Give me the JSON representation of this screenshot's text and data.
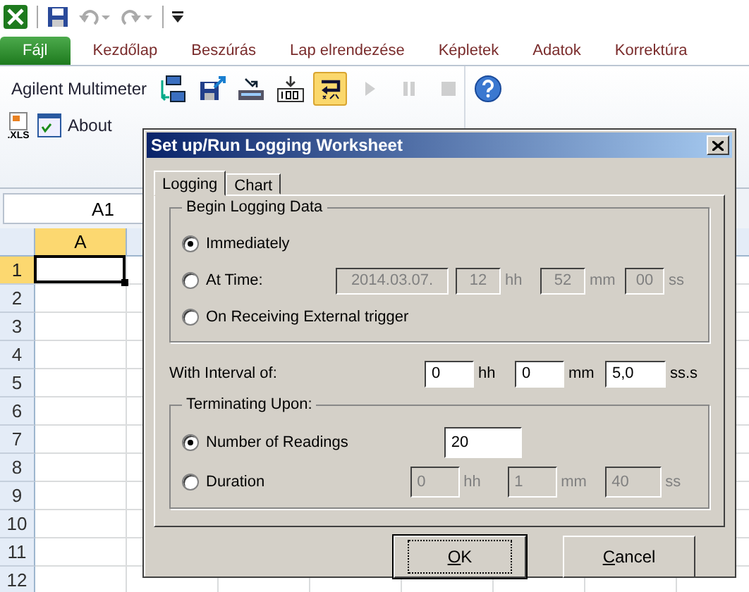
{
  "ribbon_tabs": [
    {
      "label": "Fájl",
      "kind": "file"
    },
    {
      "label": "Kezdőlap",
      "kind": "tab"
    },
    {
      "label": "Beszúrás",
      "kind": "tab"
    },
    {
      "label": "Lap elrendezése",
      "kind": "tab"
    },
    {
      "label": "Képletek",
      "kind": "tab"
    },
    {
      "label": "Adatok",
      "kind": "tab"
    },
    {
      "label": "Korrektúra",
      "kind": "tab"
    }
  ],
  "ribbon": {
    "addin_label": "Agilent Multimeter",
    "about_label": "About",
    "xls_icon_text": ".XLS",
    "tools": [
      {
        "kind": "connect",
        "active": false,
        "disabled": false
      },
      {
        "kind": "save",
        "active": false,
        "disabled": false
      },
      {
        "kind": "meter",
        "active": false,
        "disabled": false
      },
      {
        "kind": "reading",
        "active": false,
        "disabled": false
      },
      {
        "kind": "logging",
        "active": true,
        "disabled": false
      },
      {
        "kind": "play",
        "active": false,
        "disabled": true
      },
      {
        "kind": "pause",
        "active": false,
        "disabled": true
      },
      {
        "kind": "stop",
        "active": false,
        "disabled": true
      },
      {
        "kind": "help",
        "active": false,
        "disabled": false
      }
    ]
  },
  "name_box": "A1",
  "columns": [
    {
      "label": "A",
      "selected": true
    }
  ],
  "rows": [
    {
      "label": "1",
      "selected": true
    },
    {
      "label": "2",
      "selected": false
    },
    {
      "label": "3",
      "selected": false
    },
    {
      "label": "4",
      "selected": false
    },
    {
      "label": "5",
      "selected": false
    },
    {
      "label": "6",
      "selected": false
    },
    {
      "label": "7",
      "selected": false
    },
    {
      "label": "8",
      "selected": false
    },
    {
      "label": "9",
      "selected": false
    },
    {
      "label": "10",
      "selected": false
    },
    {
      "label": "11",
      "selected": false
    },
    {
      "label": "12",
      "selected": false
    }
  ],
  "dialog": {
    "title": "Set up/Run Logging Worksheet",
    "tabs": [
      {
        "label": "Logging",
        "selected": true
      },
      {
        "label": "Chart",
        "selected": false
      }
    ],
    "begin_group": {
      "title": "Begin Logging Data",
      "options": [
        {
          "label": "Immediately",
          "selected": true
        },
        {
          "label": "At Time:",
          "selected": false
        },
        {
          "label": "On Receiving External trigger",
          "selected": false
        }
      ],
      "time_fields": [
        {
          "value": "2014.03.07.",
          "disabled": true
        },
        {
          "value": "12",
          "unit": "hh",
          "disabled": true
        },
        {
          "value": "52",
          "unit": "mm",
          "disabled": true
        },
        {
          "value": "00",
          "unit": "ss",
          "disabled": true
        }
      ]
    },
    "interval": {
      "label": "With Interval of:",
      "fields": [
        {
          "value": "0",
          "unit": "hh",
          "disabled": false
        },
        {
          "value": "0",
          "unit": "mm",
          "disabled": false
        },
        {
          "value": "5,0",
          "unit": "ss.s",
          "disabled": false
        }
      ]
    },
    "terminating_group": {
      "title": "Terminating Upon:",
      "options": [
        {
          "label": "Number of Readings",
          "selected": true
        },
        {
          "label": "Duration",
          "selected": false
        }
      ],
      "readings_field": {
        "value": "20",
        "disabled": false
      },
      "duration_fields": [
        {
          "value": "0",
          "unit": "hh",
          "disabled": true
        },
        {
          "value": "1",
          "unit": "mm",
          "disabled": true
        },
        {
          "value": "40",
          "unit": "ss",
          "disabled": true
        }
      ]
    },
    "buttons": [
      {
        "label": "OK",
        "default": true
      },
      {
        "label": "Cancel",
        "default": false
      }
    ]
  }
}
